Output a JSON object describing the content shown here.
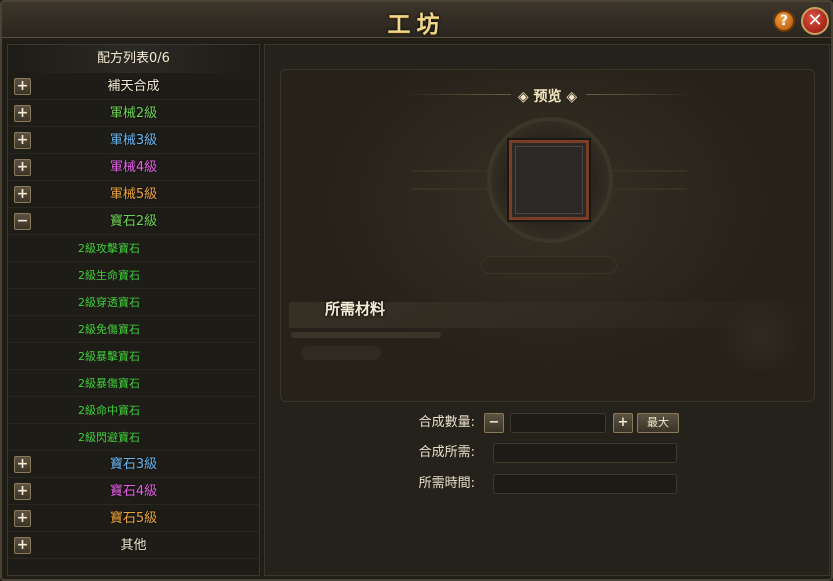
{
  "window": {
    "title": "工坊"
  },
  "title_buttons": {
    "help": "?",
    "close": "✕"
  },
  "recipe_list": {
    "header": "配方列表0/6",
    "categories_top": [
      {
        "label": "補天合成",
        "color": "#f3ead4",
        "toggle": "+"
      },
      {
        "label": "軍械2級",
        "color": "#6fd254",
        "toggle": "+"
      },
      {
        "label": "軍械3級",
        "color": "#69b5ee",
        "toggle": "+"
      },
      {
        "label": "軍械4級",
        "color": "#e55fe5",
        "toggle": "+"
      },
      {
        "label": "軍械5級",
        "color": "#eba43a",
        "toggle": "+"
      },
      {
        "label": "寶石2級",
        "color": "#6fd254",
        "toggle": "−"
      }
    ],
    "gem2_items": [
      "2級攻擊寶石",
      "2級生命寶石",
      "2級穿透寶石",
      "2級免傷寶石",
      "2級暴擊寶石",
      "2級暴傷寶石",
      "2級命中寶石",
      "2級閃避寶石"
    ],
    "categories_bottom": [
      {
        "label": "寶石3級",
        "color": "#69b5ee",
        "toggle": "+"
      },
      {
        "label": "寶石4級",
        "color": "#e55fe5",
        "toggle": "+"
      },
      {
        "label": "寶石5級",
        "color": "#eba43a",
        "toggle": "+"
      },
      {
        "label": "其他",
        "color": "#f3ead4",
        "toggle": "+"
      }
    ]
  },
  "preview": {
    "title": "◈ 预览 ◈",
    "materials_title": "所需材料"
  },
  "form": {
    "quantity_label": "合成數量:",
    "minus": "−",
    "plus": "+",
    "max_label": "最大",
    "cost_label": "合成所需:",
    "time_label": "所需時間:"
  }
}
